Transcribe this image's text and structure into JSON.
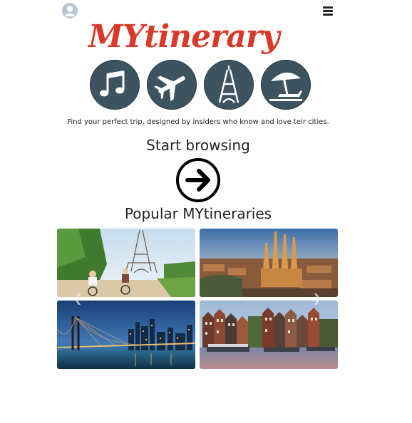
{
  "header": {
    "avatar_icon": "user-avatar-icon",
    "menu_icon": "hamburger-menu-icon"
  },
  "logo": {
    "text": "MYtinerary",
    "color": "#d9392a",
    "icons": [
      "music-notes-icon",
      "airplane-icon",
      "eiffel-tower-icon",
      "beach-umbrella-icon"
    ],
    "icon_bg": "#3d5360"
  },
  "tagline": "Find your perfect trip, designed by insiders who know and love teir cities.",
  "start": {
    "title": "Start browsing",
    "arrow_icon": "arrow-right-circle-icon"
  },
  "popular": {
    "title": "Popular MYtineraries",
    "cities": [
      {
        "name": "",
        "scene": "paris"
      },
      {
        "name": "",
        "scene": "barcelona"
      },
      {
        "name": "",
        "scene": "new-york"
      },
      {
        "name": "",
        "scene": "amsterdam"
      }
    ],
    "prev_icon": "chevron-left-icon",
    "next_icon": "chevron-right-icon"
  }
}
